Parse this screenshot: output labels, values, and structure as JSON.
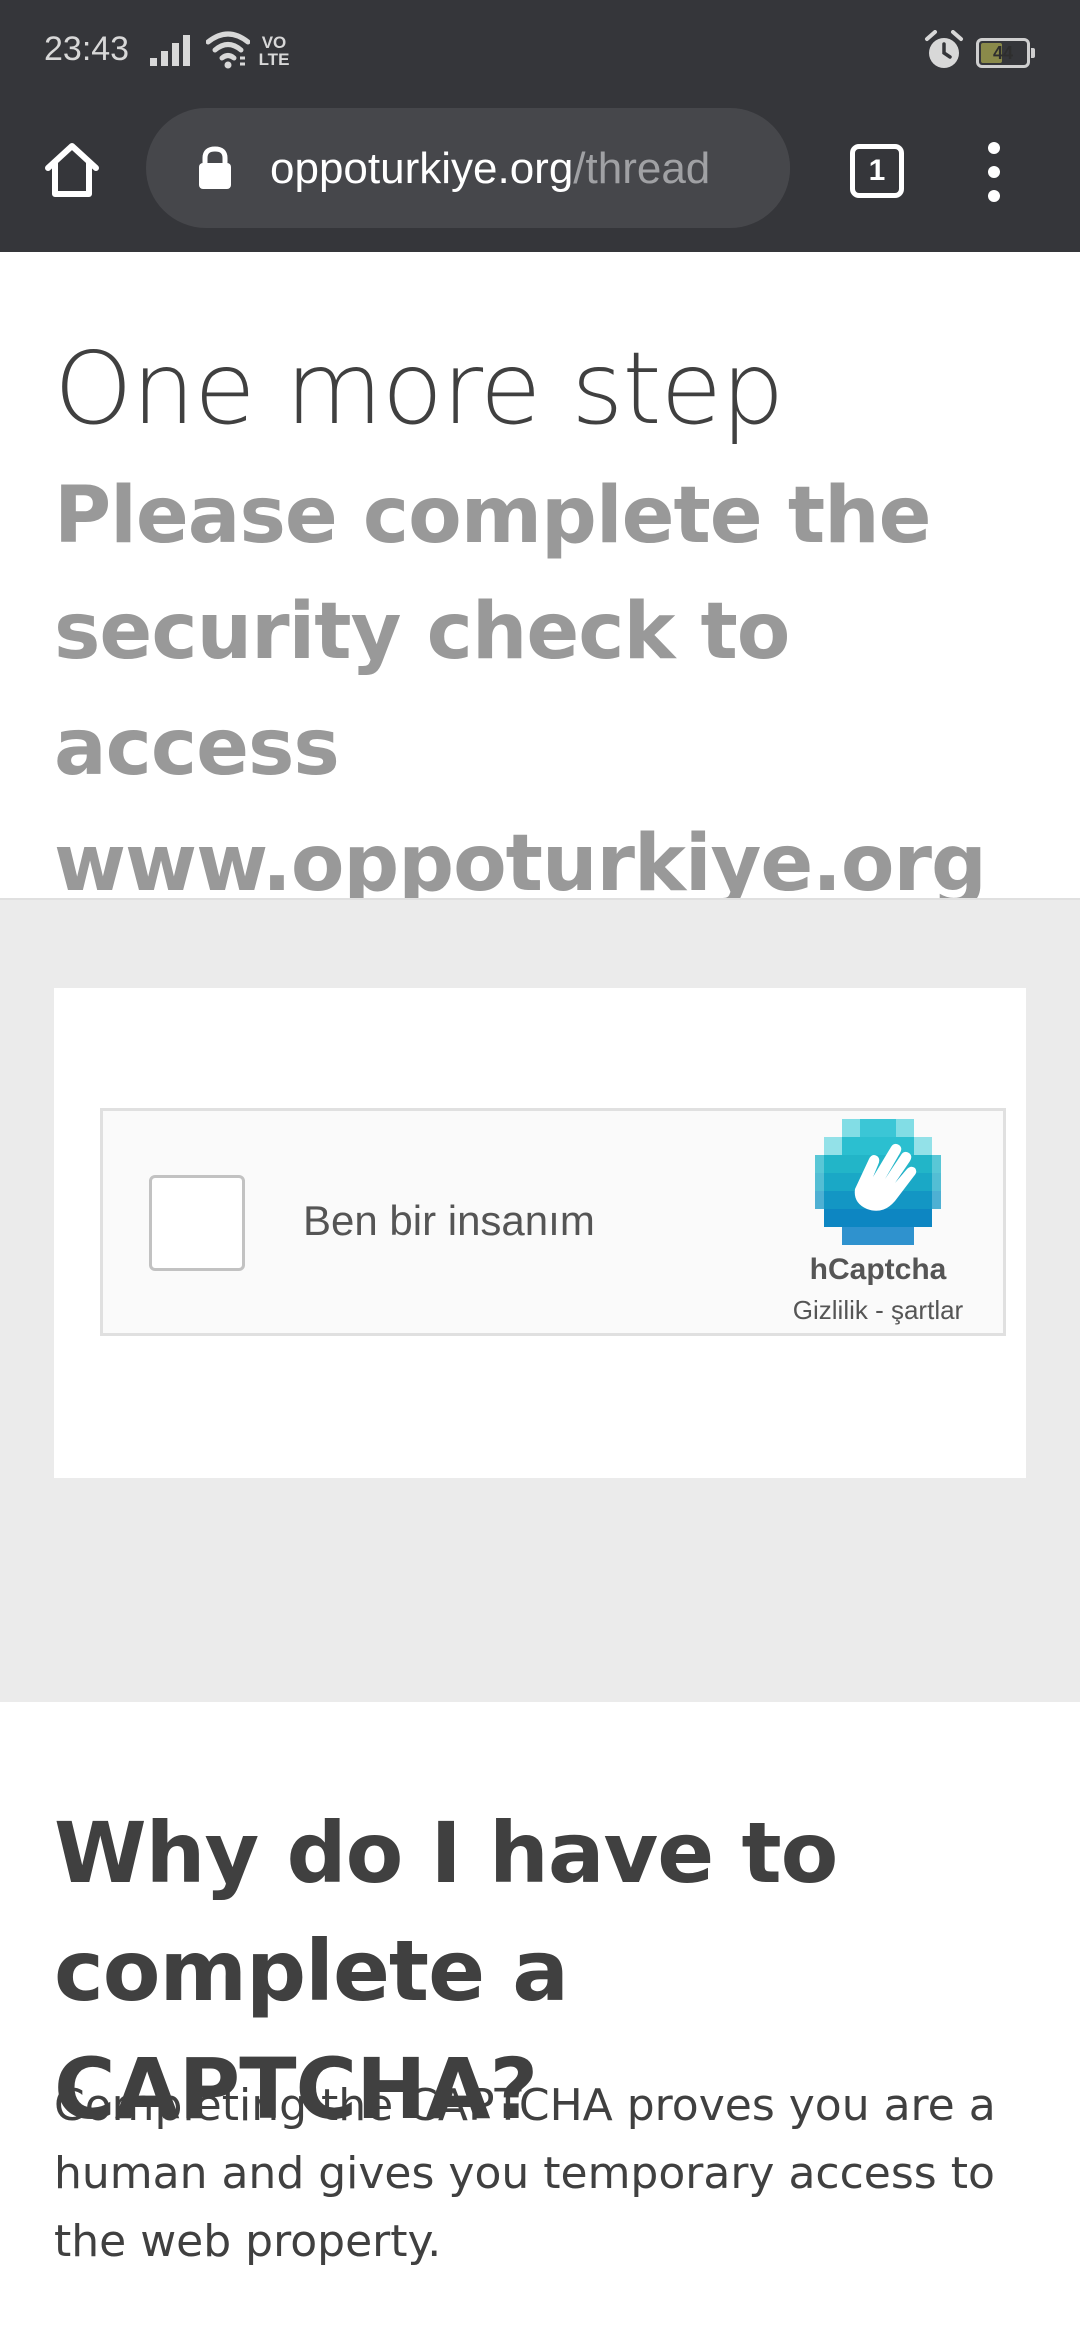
{
  "status_bar": {
    "time": "23:43",
    "network_badge_top": "VO",
    "network_badge_bottom": "LTE",
    "battery_level": "44",
    "battery_fraction": 0.44,
    "icons": [
      "signal-icon",
      "wifi-icon",
      "alarm-icon",
      "battery-icon"
    ]
  },
  "browser": {
    "url_host": "oppoturkiye.org",
    "url_path": "/thread",
    "tab_count": "1",
    "icons": [
      "home-icon",
      "lock-icon",
      "tab-switcher-icon",
      "overflow-menu-icon"
    ]
  },
  "page": {
    "title": "One more step",
    "subtitle": "Please complete the security check to access www.oppoturkiye.org",
    "captcha": {
      "checkbox_label": "Ben bir insanım",
      "brand": "hCaptcha",
      "links": "Gizlilik - şartlar",
      "checked": false
    },
    "why_heading": "Why do I have to complete a CAPTCHA?",
    "why_body": "Completing the CAPTCHA proves you are a human and gives you temporary access to the web property."
  },
  "colors": {
    "chrome_bar": "#35363a",
    "omnibox": "#46474b",
    "captcha_section_bg": "#ebebeb",
    "title_text": "#404040",
    "subtitle_text": "#999999",
    "hcaptcha_teal": "#1fb7c9",
    "hcaptcha_blue": "#0a7fc5"
  }
}
